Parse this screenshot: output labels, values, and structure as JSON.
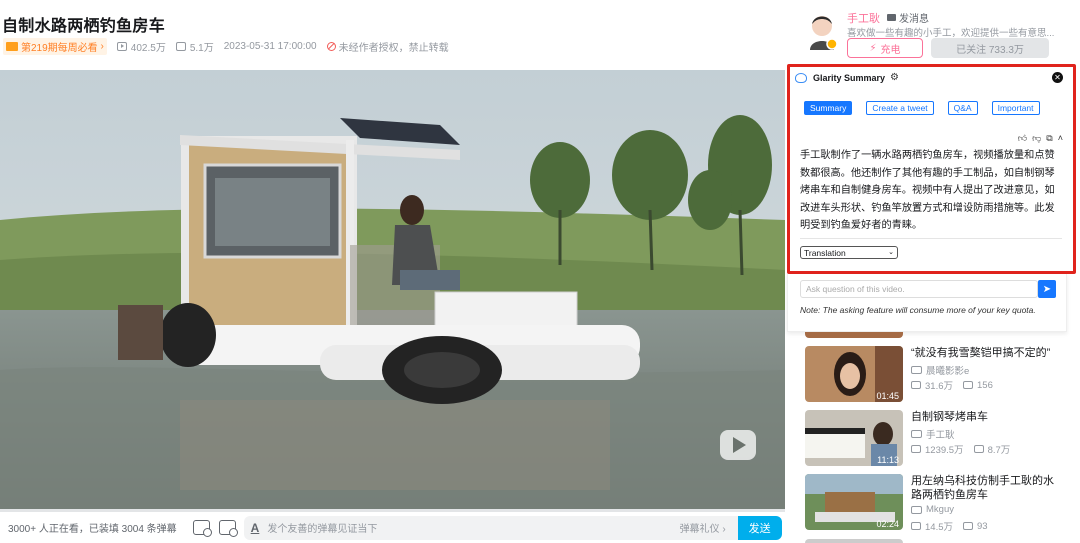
{
  "video": {
    "title": "自制水路两栖钓鱼房车",
    "weekly_badge": "第219期每周必看",
    "views": "402.5万",
    "danmaku_count": "5.1万",
    "publish_time": "2023-05-31 17:00:00",
    "copyright": "未经作者授权，禁止转载",
    "progress_percent": 0
  },
  "danmaku_bar": {
    "viewers_text": "3000+ 人正在看，已装填 3004 条弹幕",
    "input_placeholder": "发个友善的弹幕见证当下",
    "etiquette": "弹幕礼仪 ›",
    "send_label": "发送"
  },
  "uploader": {
    "name": "手工耿",
    "message_label": "发消息",
    "description": "喜欢做一些有趣的小手工，欢迎提供一些有意思...",
    "charge_label": "充电",
    "follow_label": "已关注 733.3万"
  },
  "glarity": {
    "title": "Glarity Summary",
    "tabs": [
      "Summary",
      "Create a tweet",
      "Q&A",
      "Important"
    ],
    "active_tab": "Summary",
    "summary": "手工耿制作了一辆水路两栖钓鱼房车，视频播放量和点赞数都很高。他还制作了其他有趣的手工制品，如自制钢琴烤串车和自制健身房车。视频中有人提出了改进意见，如改进车头形状、钓鱼竿放置方式和增设防雨措施等。此发明受到钓鱼爱好者的青睐。",
    "translation_label": "Translation",
    "ask_placeholder": "Ask question of this video.",
    "ask_note": "Note: The asking feature will consume more of your key quota.",
    "highlight_color": "#e0231c",
    "accent_color": "#1677ff"
  },
  "recommendations": [
    {
      "title": "“就没有我雪獒铠甲搞不定的”",
      "uploader": "晨曦影影e",
      "views": "31.6万",
      "danmaku": "156",
      "duration": "01:45"
    },
    {
      "title": "自制钢琴烤串车",
      "uploader": "手工耿",
      "views": "1239.5万",
      "danmaku": "8.7万",
      "duration": "11:13"
    },
    {
      "title": "用左纳乌科技仿制手工耿的水路两栖钓鱼房车",
      "uploader": "Mkguy",
      "views": "14.5万",
      "danmaku": "93",
      "duration": "02:24"
    }
  ],
  "colors": {
    "bilibili_blue": "#00aeec",
    "bilibili_pink": "#fb7299"
  }
}
